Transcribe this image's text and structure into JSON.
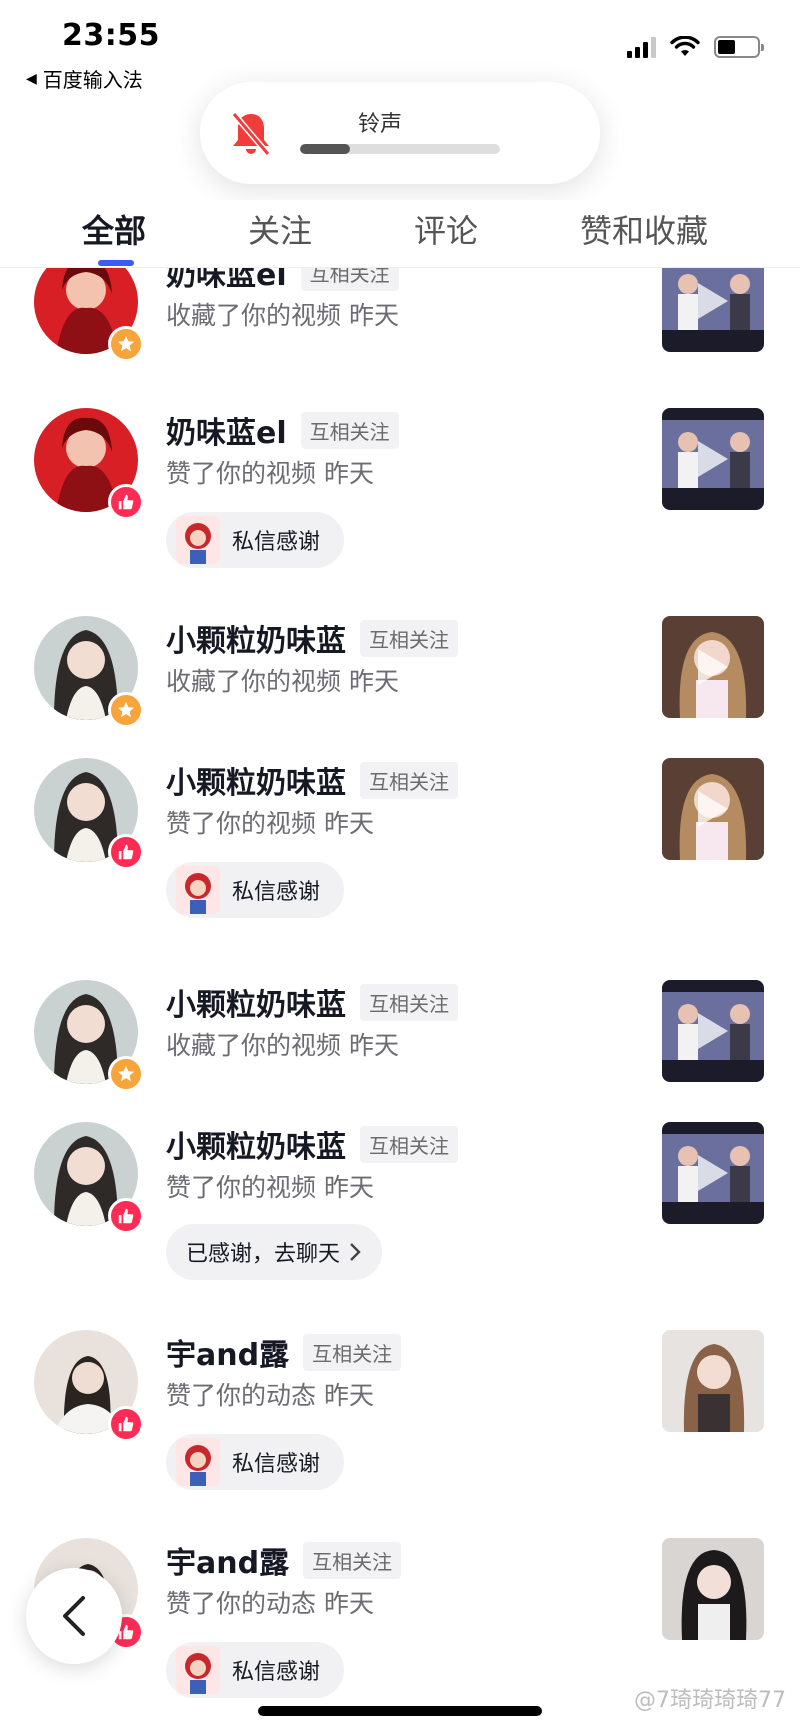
{
  "status_bar": {
    "time": "23:55",
    "back_app": "百度输入法",
    "back_icon": "back-triangle-icon",
    "battery_level": 0.45
  },
  "ringtone": {
    "label": "铃声",
    "icon": "bell-slash-icon",
    "volume_level": 0.25,
    "accent_color": "#f23b3b"
  },
  "tabs": [
    {
      "label": "全部",
      "active": true
    },
    {
      "label": "关注",
      "active": false
    },
    {
      "label": "评论",
      "active": false
    },
    {
      "label": "赞和收藏",
      "active": false
    }
  ],
  "colors": {
    "tab_indicator": "#3a5cf5",
    "like_badge": "#fe2c55",
    "star_badge": "#f7a53a"
  },
  "notifications": [
    {
      "name": "奶味蓝el",
      "tag": "互相关注",
      "action": "收藏了你的视频 昨天",
      "badge": "star-icon",
      "button": null
    },
    {
      "name": "奶味蓝el",
      "tag": "互相关注",
      "action": "赞了你的视频 昨天",
      "badge": "thumbs-up-icon",
      "button": "私信感谢"
    },
    {
      "name": "小颗粒奶味蓝",
      "tag": "互相关注",
      "action": "收藏了你的视频 昨天",
      "badge": "star-icon",
      "button": null
    },
    {
      "name": "小颗粒奶味蓝",
      "tag": "互相关注",
      "action": "赞了你的视频 昨天",
      "badge": "thumbs-up-icon",
      "button": "私信感谢"
    },
    {
      "name": "小颗粒奶味蓝",
      "tag": "互相关注",
      "action": "收藏了你的视频 昨天",
      "badge": "star-icon",
      "button": null
    },
    {
      "name": "小颗粒奶味蓝",
      "tag": "互相关注",
      "action": "赞了你的视频 昨天",
      "badge": "thumbs-up-icon",
      "button": "已感谢，去聊天"
    },
    {
      "name": "宇and露",
      "tag": "互相关注",
      "action": "赞了你的动态 昨天",
      "badge": "thumbs-up-icon",
      "button": "私信感谢"
    },
    {
      "name": "宇and露",
      "tag": "互相关注",
      "action": "赞了你的动态 昨天",
      "badge": "thumbs-up-icon",
      "button": "私信感谢"
    }
  ],
  "watermark": "@7琦琦琦琦77"
}
